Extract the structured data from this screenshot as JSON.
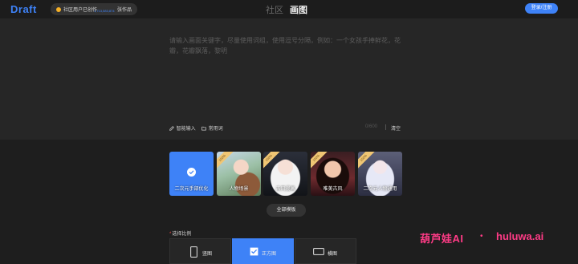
{
  "header": {
    "logo_text": "Draft",
    "stats": {
      "prefix": "社区用户已创作",
      "count": "1,713,583,874",
      "suffix": "张作品"
    },
    "nav": [
      {
        "label": "社区"
      },
      {
        "label": "画图"
      }
    ],
    "login_label": "登录/注册"
  },
  "prompt": {
    "placeholder": "请输入画面关键字，尽量使用词组，使用逗号分隔，例如：一个女孩手捧鲜花，花瓣，花瓣飘落，黎明"
  },
  "tools": {
    "smart_input": "智能输入",
    "common_words": "常用词",
    "counter": "0/600",
    "clear": "清空"
  },
  "templates": {
    "items": [
      {
        "label": "二次元手部优化",
        "badge": "",
        "selected": true
      },
      {
        "label": "人物场景",
        "badge": "100%",
        "selected": false
      },
      {
        "label": "古风漫画",
        "badge": "100%",
        "selected": false
      },
      {
        "label": "唯美古风",
        "badge": "100%",
        "selected": false
      },
      {
        "label": "二次元人物通用",
        "badge": "100%",
        "selected": false
      }
    ],
    "all_label": "全部模板"
  },
  "ratio": {
    "title": "选择比例",
    "required_mark": "*",
    "options": [
      {
        "label": "竖图",
        "selected": false
      },
      {
        "label": "正方图",
        "selected": true
      },
      {
        "label": "横图",
        "selected": false
      }
    ]
  },
  "watermark": {
    "cn": "葫芦娃AI",
    "dot": "•",
    "url": "huluwa.ai"
  },
  "colors": {
    "accent": "#3e82f7",
    "background": "#262626",
    "topbar": "#1c1c1c",
    "watermark": "#ff3b86",
    "badge": "#f0c674"
  },
  "icons": {
    "smart_input": "pen-icon",
    "common_words": "folder-icon",
    "selected": "check-icon",
    "portrait": "portrait-rect-icon",
    "square": "checkbox-check-icon",
    "landscape": "landscape-rect-icon"
  }
}
